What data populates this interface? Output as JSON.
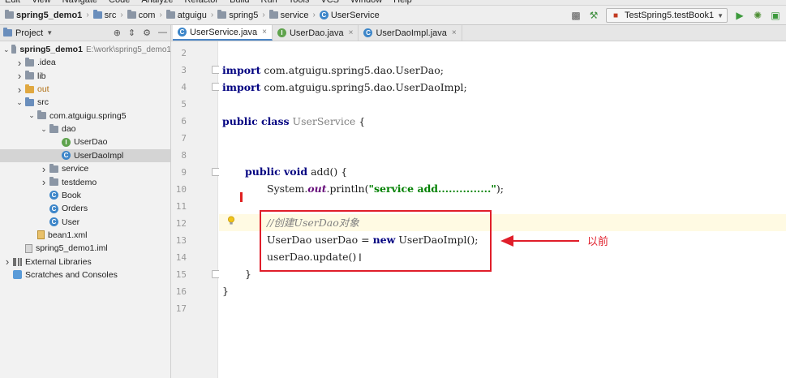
{
  "menu": [
    "Edit",
    "View",
    "Navigate",
    "Code",
    "Analyze",
    "Refactor",
    "Build",
    "Run",
    "Tools",
    "VCS",
    "Window",
    "Help"
  ],
  "breadcrumbs": [
    "spring5_demo1",
    "src",
    "com",
    "atguigu",
    "spring5",
    "service",
    "UserService"
  ],
  "run_config": "TestSpring5.testBook1",
  "project_panel": {
    "title": "Project"
  },
  "tree": [
    {
      "label": "spring5_demo1",
      "hint": "E:\\work\\spring5_demo1",
      "depth": 0,
      "arrow": "open",
      "icon": "module",
      "bold": true
    },
    {
      "label": ".idea",
      "depth": 1,
      "arrow": "closed",
      "icon": "folder"
    },
    {
      "label": "lib",
      "depth": 1,
      "arrow": "closed",
      "icon": "folder"
    },
    {
      "label": "out",
      "depth": 1,
      "arrow": "closed",
      "icon": "folder-orange",
      "orange": true
    },
    {
      "label": "src",
      "depth": 1,
      "arrow": "open",
      "icon": "folder-blue"
    },
    {
      "label": "com.atguigu.spring5",
      "depth": 2,
      "arrow": "open",
      "icon": "package"
    },
    {
      "label": "dao",
      "depth": 3,
      "arrow": "open",
      "icon": "package"
    },
    {
      "label": "UserDao",
      "depth": 4,
      "arrow": "none",
      "icon": "interface"
    },
    {
      "label": "UserDaoImpl",
      "depth": 4,
      "arrow": "none",
      "icon": "class",
      "selected": true
    },
    {
      "label": "service",
      "depth": 3,
      "arrow": "closed",
      "icon": "package"
    },
    {
      "label": "testdemo",
      "depth": 3,
      "arrow": "closed",
      "icon": "package"
    },
    {
      "label": "Book",
      "depth": 3,
      "arrow": "none",
      "icon": "class"
    },
    {
      "label": "Orders",
      "depth": 3,
      "arrow": "none",
      "icon": "class"
    },
    {
      "label": "User",
      "depth": 3,
      "arrow": "none",
      "icon": "class"
    },
    {
      "label": "bean1.xml",
      "depth": 2,
      "arrow": "none",
      "icon": "xml"
    },
    {
      "label": "spring5_demo1.iml",
      "depth": 1,
      "arrow": "none",
      "icon": "iml"
    },
    {
      "label": "External Libraries",
      "depth": 0,
      "arrow": "closed",
      "icon": "library"
    },
    {
      "label": "Scratches and Consoles",
      "depth": 0,
      "arrow": "none",
      "icon": "scratch"
    }
  ],
  "tabs": [
    {
      "label": "UserService.java",
      "icon": "class",
      "active": true
    },
    {
      "label": "UserDao.java",
      "icon": "interface",
      "active": false
    },
    {
      "label": "UserDaoImpl.java",
      "icon": "class",
      "active": false
    }
  ],
  "line_numbers": [
    "2",
    "3",
    "4",
    "5",
    "6",
    "7",
    "8",
    "9",
    "10",
    "11",
    "12",
    "13",
    "14",
    "15",
    "16",
    "17"
  ],
  "code": {
    "l3": {
      "kw": "import",
      "rest": " com.atguigu.spring5.dao.UserDao;"
    },
    "l4": {
      "kw": "import",
      "rest": " com.atguigu.spring5.dao.UserDaoImpl;"
    },
    "l6": {
      "kw": "public class",
      "name": " UserService",
      "rest": " {"
    },
    "l9": {
      "kw": "public void",
      "rest": " add() {"
    },
    "l10": {
      "pre": "System.",
      "field": "out",
      "mid": ".println(",
      "str": "\"service add...............\"",
      "post": ");"
    },
    "l12": {
      "comment": "//创建UserDao对象"
    },
    "l13": {
      "pre": "UserDao userDao = ",
      "kw": "new",
      "post": " UserDaoImpl();"
    },
    "l14": {
      "text": "userDao.update()"
    },
    "l15": {
      "text": "}"
    },
    "l16": {
      "text": "}"
    }
  },
  "annotation": {
    "label": "以前",
    "color": "#e01e2a"
  },
  "colors": {
    "keyword": "#000080",
    "string": "#008000",
    "comment": "#808080",
    "field": "#660e7a",
    "accent": "#4a86c7"
  }
}
